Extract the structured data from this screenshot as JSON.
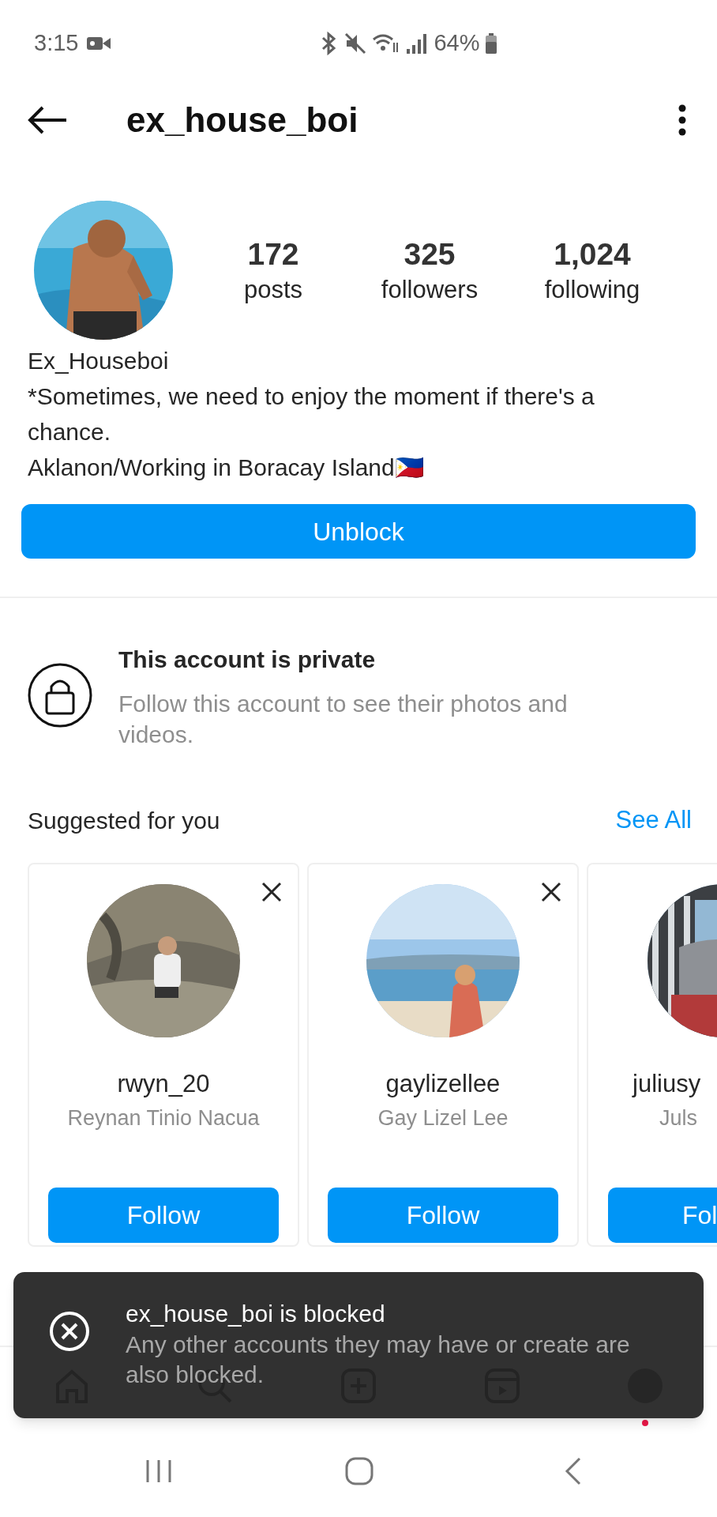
{
  "status_bar": {
    "time": "3:15",
    "battery": "64%"
  },
  "header": {
    "title": "ex_house_boi"
  },
  "profile": {
    "stats": [
      {
        "value": "172",
        "label": "posts"
      },
      {
        "value": "325",
        "label": "followers"
      },
      {
        "value": "1,024",
        "label": "following"
      }
    ],
    "name": "Ex_Houseboi",
    "bio": [
      "*Sometimes, we need to enjoy the moment if there's a chance.",
      "Aklanon/Working in Boracay Island🇵🇭"
    ],
    "button": "Unblock"
  },
  "private": {
    "title": "This account is private",
    "text": "Follow this account to see their photos and videos."
  },
  "suggested": {
    "title": "Suggested for you",
    "link": "See All",
    "cards": [
      {
        "kind": "full",
        "username": "rwyn_20",
        "full_name": "Reynan Tinio Nacua",
        "button": "Follow"
      },
      {
        "kind": "full",
        "username": "gaylizellee",
        "full_name": "Gay Lizel Lee",
        "button": "Follow"
      },
      {
        "kind": "cut",
        "username": "juliusy",
        "full_name": "Juls",
        "button": "Fol"
      }
    ]
  },
  "toast": {
    "title": "ex_house_boi is blocked",
    "text": "Any other accounts they may have or create are also blocked."
  }
}
